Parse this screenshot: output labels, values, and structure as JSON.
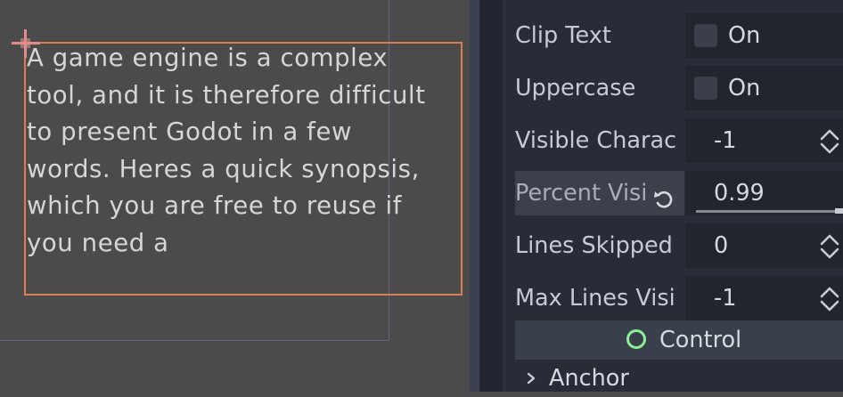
{
  "viewport": {
    "label_text": "A game engine is a complex\ntool, and it is therefore difficult\nto present Godot in a few\nwords. Heres a quick synopsis,\nwhich you are free to reuse if\nyou need a",
    "label_rect_color": "#d77f4e"
  },
  "inspector": {
    "properties": [
      {
        "name": "Clip Text",
        "checked": false,
        "label": "On"
      },
      {
        "name": "Uppercase",
        "checked": false,
        "label": "On"
      },
      {
        "name": "Visible Charac",
        "value": "-1"
      },
      {
        "name": "Percent Visi",
        "value": "0.99",
        "slider_fraction": 0.99
      },
      {
        "name": "Lines Skipped",
        "value": "0"
      },
      {
        "name": "Max Lines Visi",
        "value": "-1"
      }
    ],
    "section": {
      "title": "Control",
      "icon": "control-node-icon",
      "icon_color": "#8eef97"
    },
    "subsection": {
      "title": "Anchor",
      "icon": "chevron-right-icon"
    }
  }
}
